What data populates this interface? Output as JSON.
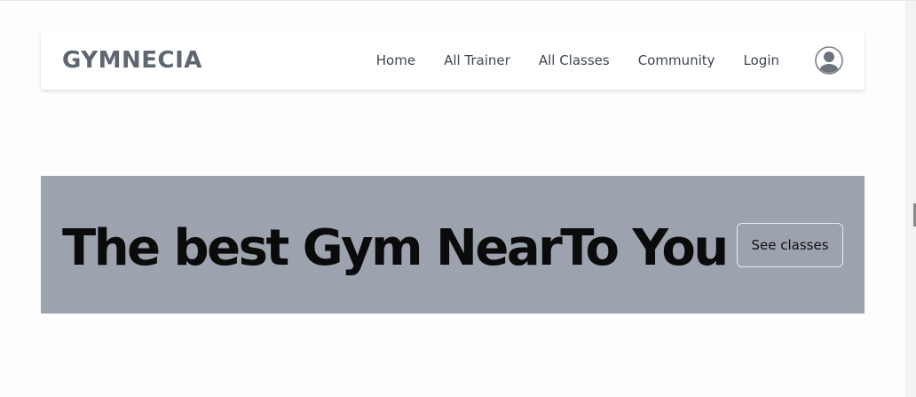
{
  "navbar": {
    "brand": "GYMNECIA",
    "links": [
      {
        "label": "Home"
      },
      {
        "label": "All Trainer"
      },
      {
        "label": "All Classes"
      },
      {
        "label": "Community"
      },
      {
        "label": "Login"
      }
    ],
    "avatar_icon": "user-circle-icon"
  },
  "hero": {
    "title": "The best Gym NearTo You",
    "button_label": "See classes",
    "background_color": "#9ca2ae"
  },
  "colors": {
    "brand_text": "#5f6670",
    "nav_text": "#3f4650",
    "hero_text": "#0b0b0b"
  }
}
